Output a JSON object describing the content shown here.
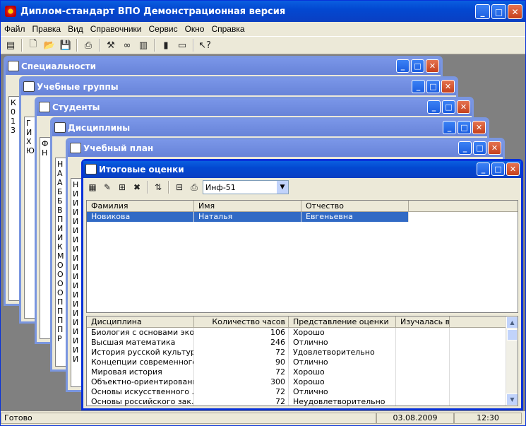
{
  "app": {
    "title": "Диплом-стандарт ВПО Демонстрационная версия"
  },
  "menu": [
    "Файл",
    "Правка",
    "Вид",
    "Справочники",
    "Сервис",
    "Окно",
    "Справка"
  ],
  "windows": {
    "specialties": {
      "title": "Специальности",
      "stub": "К\n0\n1\n3"
    },
    "groups": {
      "title": "Учебные группы",
      "stub": "Г\nИ\nХ\nЮ"
    },
    "students": {
      "title": "Студенты",
      "stub": "Ф\nН"
    },
    "disciplines": {
      "title": "Дисциплины",
      "stub": "Н\nА\nА\nБ\nБ\nВ\nП\nИ\nИ\nК\nМ\nО\nО\nО\nО\nП\nП\nП\nП\nР"
    },
    "plan": {
      "title": "Учебный план",
      "stub": "Н\nИ\nИ\nИ\nИ\nИ\nИ\nИ\nИ\nИ\nИ\nИ\nИ\nИ\nИ\nИ\nИ\nИ\nИ\nИ"
    },
    "grades": {
      "title": "Итоговые оценки",
      "group_value": "Инф-51",
      "students_headers": [
        "Фамилия",
        "Имя",
        "Отчество"
      ],
      "students": [
        [
          "Новикова",
          "Наталья",
          "Евгеньевна"
        ]
      ],
      "grade_headers": [
        "Дисциплина",
        "Количество часов",
        "Представление оценки",
        "Изучалась в"
      ],
      "grades": [
        [
          "Биология с основами эко...",
          "106",
          "Хорошо",
          ""
        ],
        [
          "Высшая математика",
          "246",
          "Отлично",
          ""
        ],
        [
          "История русской культуры",
          "72",
          "Удовлетворительно",
          ""
        ],
        [
          "Концепции современного...",
          "90",
          "Отлично",
          ""
        ],
        [
          "Мировая история",
          "72",
          "Хорошо",
          ""
        ],
        [
          "Объектно-ориентированн...",
          "300",
          "Хорошо",
          ""
        ],
        [
          "Основы искусственного ...",
          "72",
          "Отлично",
          ""
        ],
        [
          "Основы российского зак...",
          "72",
          "Неудовлетворительно",
          ""
        ]
      ]
    }
  },
  "status": {
    "text": "Готово",
    "date": "03.08.2009",
    "time": "12:30"
  }
}
